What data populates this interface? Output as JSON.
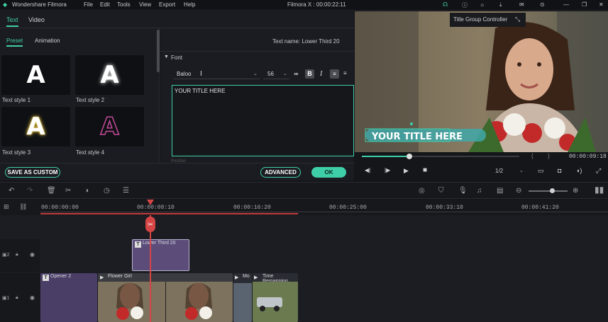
{
  "app": {
    "name": "Wondershare Filmora",
    "title": "Filmora X : 00:00:22:11"
  },
  "menu": [
    "File",
    "Edit",
    "Tools",
    "View",
    "Export",
    "Help"
  ],
  "tabs": [
    "Text",
    "Video"
  ],
  "subtabs": [
    "Preset",
    "Animation"
  ],
  "presets": [
    {
      "label": "Text style 1"
    },
    {
      "label": "Text style 2"
    },
    {
      "label": "Text style 3"
    },
    {
      "label": "Text style 4"
    }
  ],
  "preset_glyph": "A",
  "text_panel": {
    "text_name": "Text name: Lower Third 20",
    "font_section": "Font",
    "font": "Baloo",
    "size": "56",
    "content": "YOUR TITLE HERE",
    "next_section": "Position"
  },
  "buttons": {
    "save_custom": "SAVE AS CUSTOM",
    "advanced": "ADVANCED",
    "ok": "OK"
  },
  "preview": {
    "overlay_title": "Title Group Controller",
    "title_text": "YOUR TITLE HERE",
    "time": "00:00:09:18",
    "quality": "1/2",
    "progress": 0.3
  },
  "timeline": {
    "ruler": [
      "00:00:00:00",
      "00:00:08:10",
      "00:00:16:20",
      "00:00:25:00",
      "00:00:33:10",
      "00:00:41:20"
    ],
    "clips": {
      "text_clip": "Lower Third 20",
      "opener": "Opener 2",
      "flower": "Flower Girl",
      "mo": "Mo",
      "time_remap": "Time Remapping"
    }
  },
  "colors": {
    "accent": "#3fcfa8",
    "text_clip": "#5b4c7a",
    "opener_clip": "#4a3d66",
    "playhead": "#d64545"
  }
}
